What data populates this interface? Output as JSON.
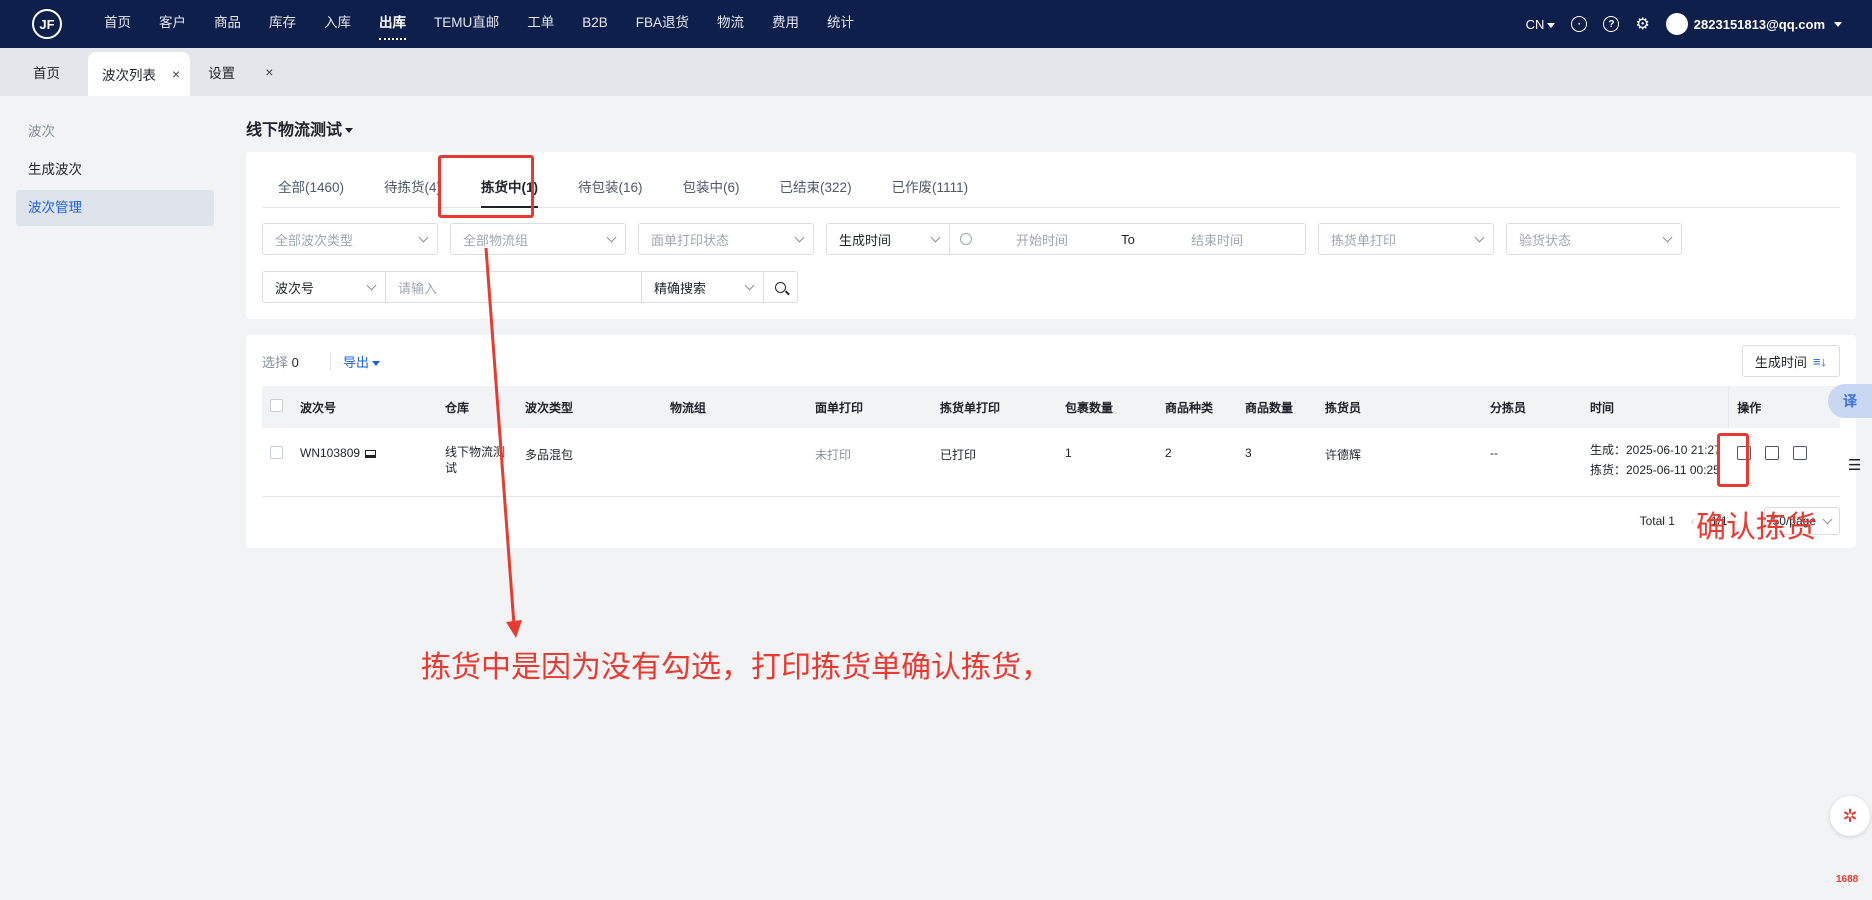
{
  "nav": {
    "logo": "JF",
    "items": [
      "首页",
      "客户",
      "商品",
      "库存",
      "入库",
      "出库",
      "TEMU直邮",
      "工单",
      "B2B",
      "FBA退货",
      "物流",
      "费用",
      "统计"
    ],
    "active_index": 5,
    "lang": "CN",
    "user": "2823151813@qq.com"
  },
  "page_tabs": [
    {
      "label": "首页"
    },
    {
      "label": "波次列表",
      "close": "×"
    },
    {
      "label": "设置",
      "close": "×"
    }
  ],
  "sidebar": {
    "title": "波次",
    "items": [
      "生成波次",
      "波次管理"
    ]
  },
  "main": {
    "title": "线下物流测试",
    "status_tabs": [
      "全部(1460)",
      "待拣货(4)",
      "拣货中(1)",
      "待包装(16)",
      "包装中(6)",
      "已结束(322)",
      "已作废(1111)"
    ],
    "filters": {
      "wave_type": "全部波次类型",
      "logistics_group": "全部物流组",
      "waybill_print": "面单打印状态",
      "time_type": "生成时间",
      "start_placeholder": "开始时间",
      "to": "To",
      "end_placeholder": "结束时间",
      "pick_print": "拣货单打印",
      "inspect_status": "验货状态",
      "search_field": "波次号",
      "search_placeholder": "请输入",
      "search_mode": "精确搜索"
    },
    "toolbar": {
      "select_label": "选择",
      "select_count": "0",
      "export": "导出",
      "sort": "生成时间"
    },
    "table": {
      "headers": [
        "波次号",
        "仓库",
        "波次类型",
        "物流组",
        "面单打印",
        "拣货单打印",
        "包裹数量",
        "商品种类",
        "商品数量",
        "拣货员",
        "分拣员",
        "时间",
        "操作"
      ],
      "rows": [
        {
          "wave_no": "WN103809",
          "warehouse": "线下物流测试",
          "wave_type": "多品混包",
          "logistics_group": "",
          "waybill_print": "未打印",
          "pick_print": "已打印",
          "packages": "1",
          "sku_kinds": "2",
          "sku_qty": "3",
          "picker": "许德辉",
          "sorter": "--",
          "created": "生成：2025-06-10 21:27",
          "picked": "拣货：2025-06-11 00:25"
        }
      ]
    },
    "pager": {
      "total": "Total 1",
      "page": "1/1",
      "size": "50/page"
    }
  },
  "annotations": {
    "main_note": "拣货中是因为没有勾选，打印拣货单确认拣货，",
    "confirm_note": "确认拣货"
  },
  "floating": {
    "translate": "译",
    "brand": "1688"
  }
}
